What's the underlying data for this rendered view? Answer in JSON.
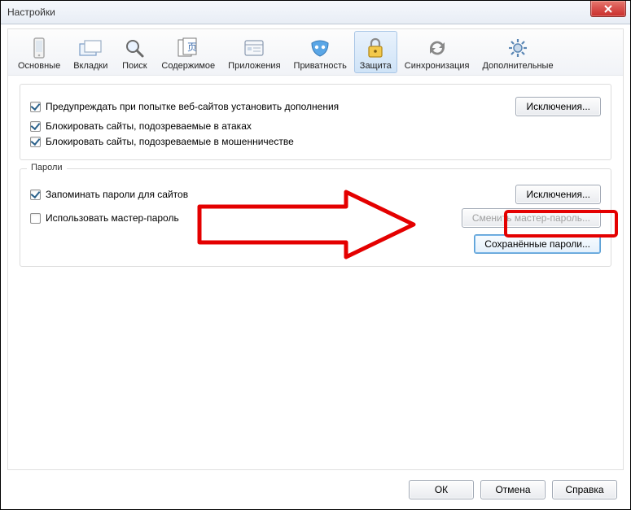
{
  "window": {
    "title": "Настройки"
  },
  "tabs": {
    "main": "Основные",
    "tabs_": "Вкладки",
    "search": "Поиск",
    "content": "Содержимое",
    "apps": "Приложения",
    "privacy": "Приватность",
    "security": "Защита",
    "sync": "Синхронизация",
    "advanced": "Дополнительные",
    "active": "security"
  },
  "security_group": {
    "warn_addons": "Предупреждать при попытке веб-сайтов установить дополнения",
    "block_attacks": "Блокировать сайты, подозреваемые в атаках",
    "block_fraud": "Блокировать сайты, подозреваемые в мошенничестве",
    "exceptions": "Исключения..."
  },
  "passwords_group": {
    "title": "Пароли",
    "remember": "Запоминать пароли для сайтов",
    "use_master": "Использовать мастер-пароль",
    "exceptions": "Исключения...",
    "change_master": "Сменить мастер-пароль...",
    "saved_passwords": "Сохранённые пароли..."
  },
  "buttons": {
    "ok": "ОК",
    "cancel": "Отмена",
    "help": "Справка"
  }
}
